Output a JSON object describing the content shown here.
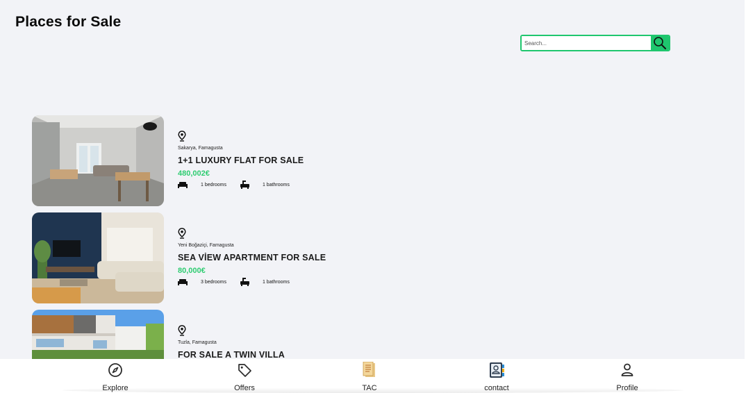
{
  "page": {
    "title": "Places for Sale"
  },
  "search": {
    "placeholder": "Search..."
  },
  "listings": [
    {
      "location": "Sakarya, Famagusta",
      "title": "1+1 LUXURY FLAT FOR SALE",
      "price": "480,002€",
      "bedrooms": "1 bedrooms",
      "bathrooms": "1 bathrooms"
    },
    {
      "location": "Yeni Boğaziçi, Famagusta",
      "title": "SEA VİEW APARTMENT FOR SALE",
      "price": "80,000€",
      "bedrooms": "3 bedrooms",
      "bathrooms": "1 bathrooms"
    },
    {
      "location": "Tuzla, Famagusta",
      "title": "FOR SALE A TWIN VILLA"
    }
  ],
  "nav": {
    "items": [
      {
        "label": "Explore",
        "icon": "compass-icon"
      },
      {
        "label": "Offers",
        "icon": "tag-icon"
      },
      {
        "label": "TAC",
        "icon": "document-icon"
      },
      {
        "label": "contact",
        "icon": "contact-book-icon"
      },
      {
        "label": "Profile",
        "icon": "user-icon"
      }
    ]
  },
  "colors": {
    "accent": "#1fc66e",
    "price": "#2ecc71",
    "background": "#f2f3f7"
  }
}
